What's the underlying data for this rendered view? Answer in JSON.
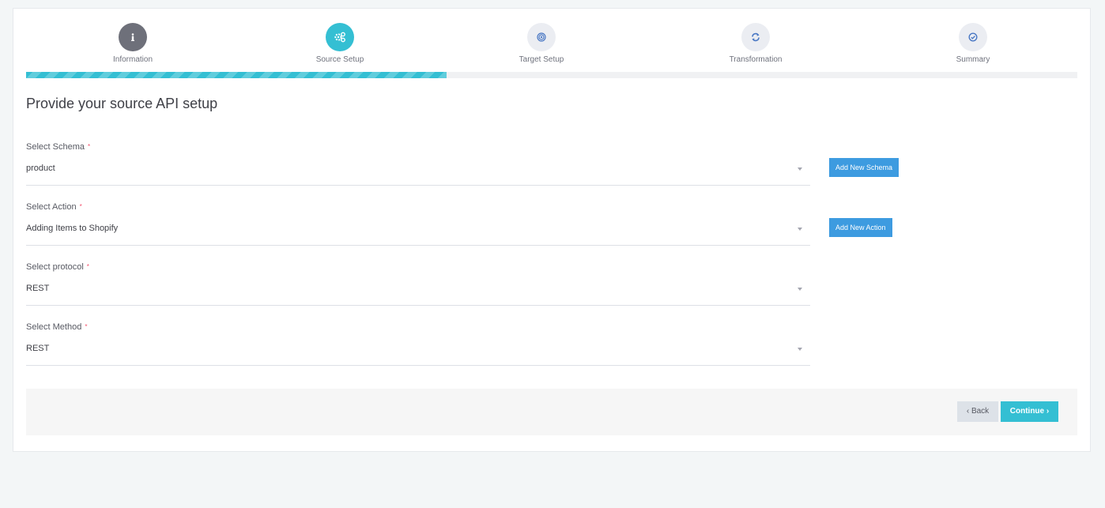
{
  "wizard": {
    "steps": [
      {
        "label": "Information",
        "icon": "info-icon",
        "state": "done"
      },
      {
        "label": "Source Setup",
        "icon": "cogs-icon",
        "state": "active"
      },
      {
        "label": "Target Setup",
        "icon": "target-icon",
        "state": "pending"
      },
      {
        "label": "Transformation",
        "icon": "refresh-icon",
        "state": "pending"
      },
      {
        "label": "Summary",
        "icon": "check-circle-icon",
        "state": "pending"
      }
    ],
    "progress_fraction": 0.4
  },
  "page": {
    "heading": "Provide your source API setup"
  },
  "form": {
    "required_mark": "*",
    "schema": {
      "label": "Select Schema",
      "value": "product"
    },
    "action": {
      "label": "Select Action",
      "value": "Adding Items to Shopify"
    },
    "protocol": {
      "label": "Select protocol",
      "value": "REST"
    },
    "method": {
      "label": "Select Method",
      "value": "REST"
    },
    "add_schema_label": "Add New Schema",
    "add_action_label": "Add New Action"
  },
  "footer": {
    "back_label": "Back",
    "continue_label": "Continue",
    "back_icon": "chevron-left-icon",
    "continue_icon": "chevron-right-icon"
  },
  "colors": {
    "accent": "#34bfd3",
    "primary_button": "#3d9be0",
    "done_step": "#6e707a",
    "pending_step": "#ebedf2",
    "required": "#f4516c"
  }
}
